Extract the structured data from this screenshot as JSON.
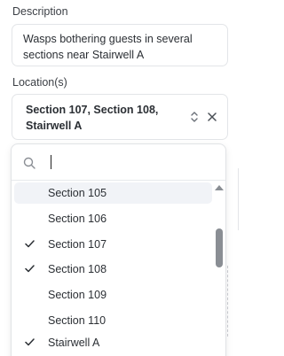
{
  "description": {
    "label": "Description",
    "value_line1": "Wasps bothering guests in several",
    "value_line2": "sections near Stairwell A"
  },
  "location": {
    "label": "Location(s)",
    "selected_line1": "Section 107, Section 108,",
    "selected_line2": "Stairwell A",
    "toggle_icon": "chevron-updown-icon",
    "clear_icon": "close-icon"
  },
  "dropdown": {
    "search_value": "",
    "search_icon": "search-icon",
    "options": [
      {
        "label": "Section 105",
        "checked": false,
        "highlighted": true
      },
      {
        "label": "Section 106",
        "checked": false,
        "highlighted": false
      },
      {
        "label": "Section 107",
        "checked": true,
        "highlighted": false
      },
      {
        "label": "Section 108",
        "checked": true,
        "highlighted": false
      },
      {
        "label": "Section 109",
        "checked": false,
        "highlighted": false
      },
      {
        "label": "Section 110",
        "checked": false,
        "highlighted": false
      },
      {
        "label": "Stairwell A",
        "checked": true,
        "highlighted": false
      }
    ]
  },
  "colors": {
    "highlight_bg": "#f1f3f7",
    "scroll_thumb": "#8a8e94",
    "border": "#e3e5e8"
  }
}
